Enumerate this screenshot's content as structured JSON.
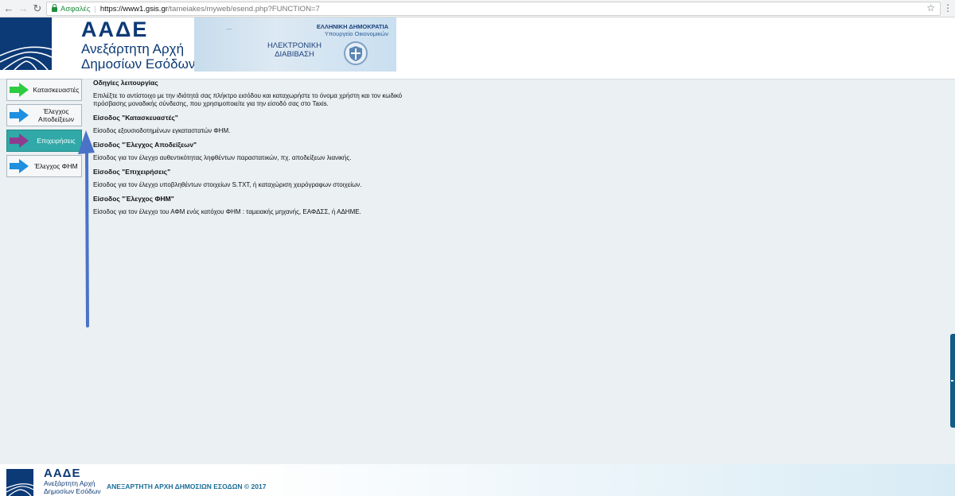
{
  "browser": {
    "secure_label": "Ασφαλές",
    "url_host": "https://www1.gsis.gr",
    "url_path": "/tameiakes/myweb/esend.php?FUNCTION=7"
  },
  "header": {
    "logo_title": "ΑΑΔΕ",
    "logo_sub_1": "Ανεξάρτητη Αρχή",
    "logo_sub_2": "Δημοσίων Εσόδων",
    "gov_title": "ΕΛΛΗΝΙΚΗ ΔΗΜΟΚΡΑΤΙΑ",
    "gov_sub": "Υπουργείο Οικονομικών",
    "eservice_1": "ΗΛΕΚΤΡΟΝΙΚΗ",
    "eservice_2": "ΔΙΑΒΙΒΑΣΗ"
  },
  "sidebar": {
    "items": [
      {
        "label_1": "Κατασκευαστές",
        "label_2": "",
        "arrow_color": "#2ecc40",
        "active": false
      },
      {
        "label_1": "Έλεγχος",
        "label_2": "Αποδείξεων",
        "arrow_color": "#1f8fe0",
        "active": false
      },
      {
        "label_1": "Επιχειρήσεις",
        "label_2": "",
        "arrow_color": "#8e3c8f",
        "active": true
      },
      {
        "label_1": "Έλεγχος ΦΗΜ",
        "label_2": "",
        "arrow_color": "#1f8fe0",
        "active": false
      }
    ]
  },
  "content": {
    "heading": "Οδηγίες λειτουργίας",
    "intro": "Επιλέξτε το αντίστοιχο με την ιδιότητά σας πλήκτρο εισόδου και καταχωρήστε το όνομα χρήστη και τον κωδικό πρόσβασης μοναδικής σύνδεσης, που χρησιμοποιείτε για την είσοδό σας στο Taxis.",
    "sections": [
      {
        "title": "Είσοδος \"Κατασκευαστές\"",
        "text": "Είσοδος εξουσιοδοτημένων εγκαταστατών ΦΗΜ."
      },
      {
        "title": "Είσοδος \"Έλεγχος Αποδείξεων\"",
        "text": "Είσοδος για τον έλεγχο αυθεντικότητας ληφθέντων παραστατικών, πχ. αποδείξεων λιανικής."
      },
      {
        "title": "Είσοδος \"Επιχειρήσεις\"",
        "text": "Είσοδος για τον έλεγχο υποβληθέντων στοιχείων S.TXT, ή καταχώριση χειρόγραφων στοιχείων."
      },
      {
        "title": "Είσοδος \"Έλεγχος ΦΗΜ\"",
        "text": "Είσοδος για τον έλεγχο του ΑΦΜ ενός κατόχου ΦΗΜ : ταμειακής μηχανής, ΕΑΦΔΣΣ, ή ΑΔΗΜΕ."
      }
    ]
  },
  "footer": {
    "title": "ΑΑΔΕ",
    "sub_1": "Ανεξάρτητη Αρχή",
    "sub_2": "Δημοσίων Εσόδων",
    "copyright": "ΑΝΕΞΑΡΤΗΤΗ ΑΡΧΗ ΔΗΜΟΣΙΩΝ ΕΣΟΔΩΝ © 2017"
  }
}
